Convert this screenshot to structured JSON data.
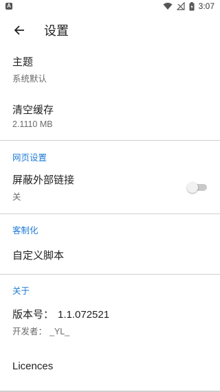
{
  "status_bar": {
    "time": "3:07",
    "app_badge": "A"
  },
  "toolbar": {
    "title": "设置"
  },
  "items": {
    "theme": {
      "title": "主题",
      "value": "系统默认"
    },
    "cache": {
      "title": "清空缓存",
      "value": "2.1110 MB"
    }
  },
  "web_section": {
    "header": "网页设置",
    "block_links": {
      "title": "屏蔽外部链接",
      "value": "关",
      "toggle_on": false
    }
  },
  "custom_section": {
    "header": "客制化",
    "scripts": {
      "title": "自定义脚本"
    }
  },
  "about_section": {
    "header": "关于",
    "version_label": "版本号：",
    "version_value": "1.1.072521",
    "developer_label": "开发者：",
    "developer_value": "_YL_",
    "licences": "Licences"
  },
  "colors": {
    "accent": "#1f7ad6",
    "divider": "#cfcfcf"
  }
}
